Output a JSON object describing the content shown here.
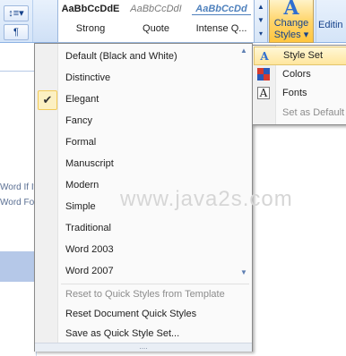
{
  "ribbon": {
    "paragraph": {
      "row1_glyph": "↕≡▾",
      "row2_glyph": "¶"
    },
    "quick_styles": [
      {
        "sample": "AaBbCcDdE",
        "label": "Strong"
      },
      {
        "sample": "AaBbCcDdI",
        "label": "Quote"
      },
      {
        "sample": "AaBbCcDd",
        "label": "Intense Q..."
      }
    ],
    "gallery_arrows": [
      "▲",
      "▼",
      "▾"
    ],
    "change_styles": {
      "icon_glyph": "A",
      "label_line1": "Change",
      "label_line2": "Styles ▾"
    },
    "editing": {
      "label": "Editin"
    }
  },
  "document": {
    "lines": [
      "Word If It",
      "Word Fo"
    ]
  },
  "style_set_menu": {
    "items": [
      {
        "label": "Default (Black and White)",
        "checked": false
      },
      {
        "label": "Distinctive",
        "checked": false
      },
      {
        "label": "Elegant",
        "checked": true
      },
      {
        "label": "Fancy",
        "checked": false
      },
      {
        "label": "Formal",
        "checked": false
      },
      {
        "label": "Manuscript",
        "checked": false
      },
      {
        "label": "Modern",
        "checked": false
      },
      {
        "label": "Simple",
        "checked": false
      },
      {
        "label": "Traditional",
        "checked": false
      },
      {
        "label": "Word 2003",
        "checked": false
      },
      {
        "label": "Word 2007",
        "checked": false
      }
    ],
    "check_glyph": "✔",
    "scroll_up": "▲",
    "scroll_down": "▼",
    "actions": [
      {
        "label": "Reset to Quick Styles from Template",
        "enabled": false
      },
      {
        "label": "Reset Document Quick Styles",
        "enabled": true
      },
      {
        "label": "Save as Quick Style Set...",
        "enabled": true
      }
    ],
    "grip": "....",
    "watermark": "www.java2s.com"
  },
  "change_styles_submenu": {
    "items": [
      {
        "label": "Style Set",
        "icon": "style-set-icon",
        "icon_glyph": "A",
        "highlighted": true,
        "enabled": true
      },
      {
        "label": "Colors",
        "icon": "colors-icon",
        "icon_glyph": "■",
        "highlighted": false,
        "enabled": true
      },
      {
        "label": "Fonts",
        "icon": "fonts-icon",
        "icon_glyph": "A",
        "highlighted": false,
        "enabled": true
      },
      {
        "label": "Set as Default",
        "icon": "",
        "icon_glyph": "",
        "highlighted": false,
        "enabled": false
      }
    ]
  },
  "colors": {
    "ribbon_bg": "#cfe0f6",
    "text_blue": "#15428b",
    "highlight": "#ffe69e",
    "check_bg": "#fcf0c2"
  }
}
